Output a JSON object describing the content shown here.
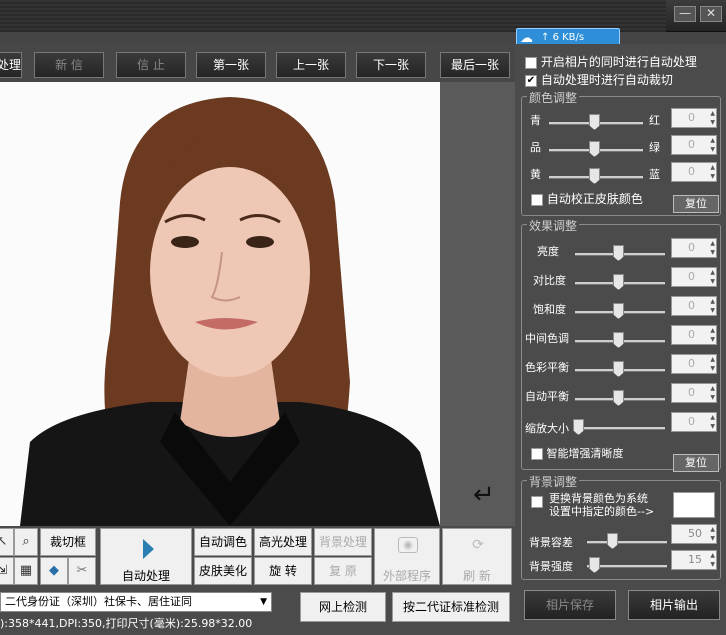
{
  "toolbar": {
    "btn_process": "处理",
    "btn_new": "新 信",
    "btn_stop": "信 止",
    "btn_first": "第一张",
    "btn_prev": "上一张",
    "btn_next": "下一张",
    "btn_last": "最后一张"
  },
  "speed_badge": "6 KB/s",
  "options": {
    "auto_process_label": "开启相片的同时进行自动处理",
    "auto_process_checked": false,
    "auto_crop_label": "自动处理时进行自动裁切",
    "auto_crop_checked": true
  },
  "color_adjust": {
    "title": "颜色调整",
    "rows": [
      {
        "left": "青",
        "right": "红",
        "value": "0"
      },
      {
        "left": "品",
        "right": "绿",
        "value": "0"
      },
      {
        "left": "黄",
        "right": "蓝",
        "value": "0"
      }
    ],
    "skin_correct_label": "自动校正皮肤颜色",
    "reset": "复位"
  },
  "effect_adjust": {
    "title": "效果调整",
    "rows": [
      {
        "label": "亮度",
        "value": "0"
      },
      {
        "label": "对比度",
        "value": "0"
      },
      {
        "label": "饱和度",
        "value": "0"
      },
      {
        "label": "中间色调",
        "value": "0"
      },
      {
        "label": "色彩平衡",
        "value": "0"
      },
      {
        "label": "自动平衡",
        "value": "0"
      },
      {
        "label": "缩放大小",
        "value": "0"
      }
    ],
    "sharpen_label": "智能增强清晰度",
    "reset": "复位"
  },
  "bg_adjust": {
    "title": "背景调整",
    "replace_label_1": "更换背景颜色为系统",
    "replace_label_2": "设置中指定的颜色-->",
    "tolerance_label": "背景容差",
    "tolerance_value": "50",
    "strength_label": "背景强度",
    "strength_value": "15"
  },
  "bottom": {
    "crop_frame": "裁切框",
    "auto_process": "自动处理",
    "auto_tone": "自动调色",
    "highlight": "高光处理",
    "bg_process": "背景处理",
    "skin": "皮肤美化",
    "rotate": "旋  转",
    "restore": "复  原",
    "external": "外部程序",
    "refresh": "刷  新"
  },
  "status": {
    "doc_type": "二代身份证（深圳）社保卡、居住证同",
    "online_check": "网上检测",
    "standard_check": "按二代证标准检测",
    "info": "):358*441,DPI:350,打印尺寸(毫米):25.98*32.00"
  },
  "actions": {
    "save": "相片保存",
    "output": "相片输出"
  },
  "icons": {
    "minimize": "minimize-icon",
    "close": "close-icon",
    "back": "return-arrow-icon"
  }
}
